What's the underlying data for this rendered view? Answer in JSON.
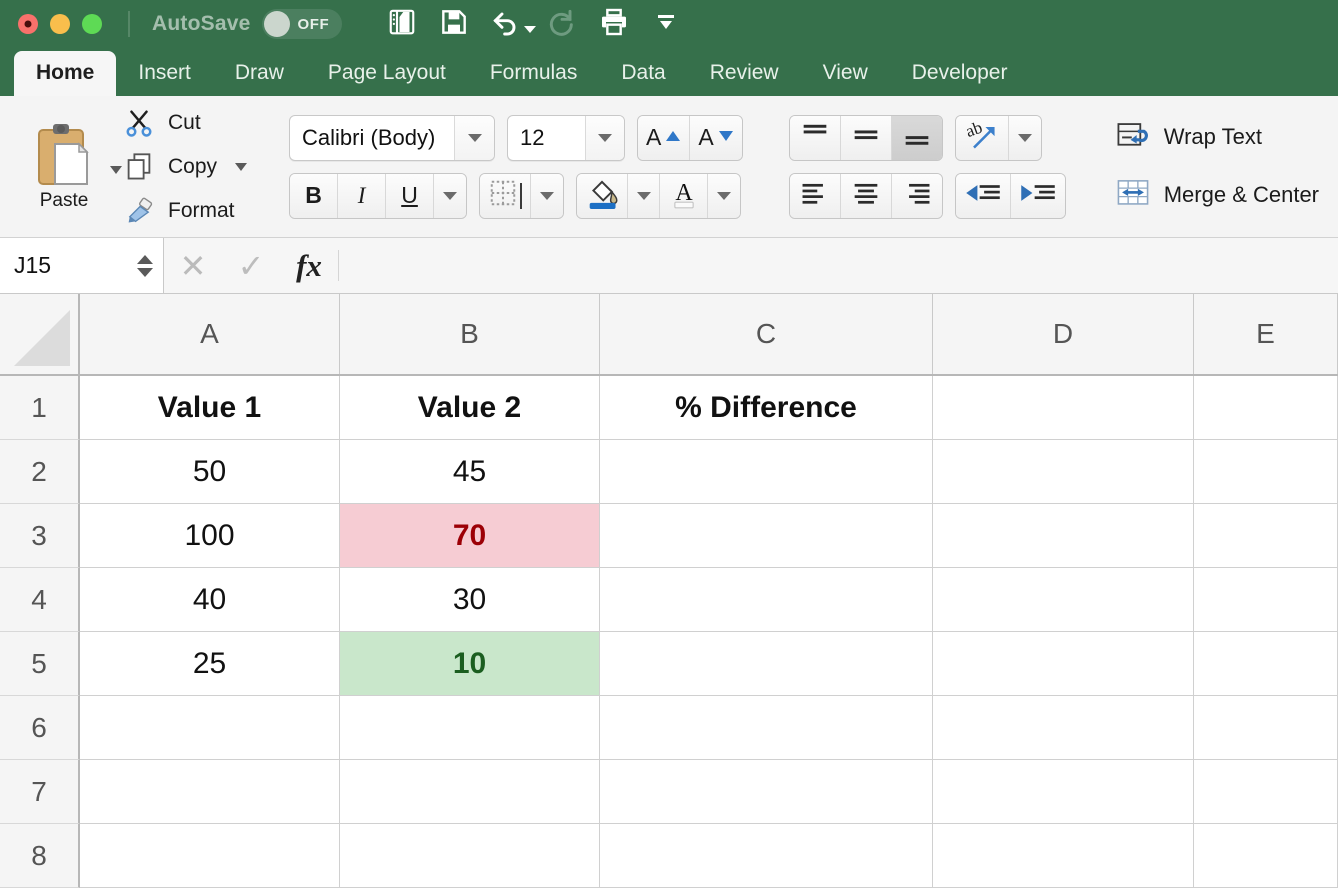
{
  "titlebar": {
    "autosave_label": "AutoSave",
    "autosave_state": "OFF",
    "buttons": [
      {
        "name": "new-from-template-icon",
        "tip": "New"
      },
      {
        "name": "save-icon",
        "tip": "Save"
      },
      {
        "name": "undo-icon",
        "tip": "Undo"
      },
      {
        "name": "redo-icon",
        "tip": "Redo"
      },
      {
        "name": "print-icon",
        "tip": "Print"
      },
      {
        "name": "customize-toolbar-icon",
        "tip": "Customize"
      }
    ],
    "green": "#36704B"
  },
  "ribbon_tabs": [
    {
      "label": "Home",
      "active": true
    },
    {
      "label": "Insert",
      "active": false
    },
    {
      "label": "Draw",
      "active": false
    },
    {
      "label": "Page Layout",
      "active": false
    },
    {
      "label": "Formulas",
      "active": false
    },
    {
      "label": "Data",
      "active": false
    },
    {
      "label": "Review",
      "active": false
    },
    {
      "label": "View",
      "active": false
    },
    {
      "label": "Developer",
      "active": false
    }
  ],
  "ribbon": {
    "clipboard": {
      "paste_label": "Paste",
      "cut_label": "Cut",
      "copy_label": "Copy",
      "format_label": "Format"
    },
    "font": {
      "font_name": "Calibri (Body)",
      "font_size": "12",
      "grow_label": "A",
      "shrink_label": "A",
      "bold_label": "B",
      "italic_label": "I",
      "underline_label": "U"
    },
    "alignment": {
      "wrap_text_label": "Wrap Text",
      "merge_center_label": "Merge & Center"
    }
  },
  "formula_bar": {
    "name_box": "J15",
    "formula_value": "",
    "cancel_label": "✕",
    "enter_label": "✓",
    "fx_label": "fx"
  },
  "sheet": {
    "columns": [
      "A",
      "B",
      "C",
      "D",
      "E"
    ],
    "rows": [
      "1",
      "2",
      "3",
      "4",
      "5",
      "6",
      "7",
      "8"
    ],
    "cells": {
      "A1": "Value 1",
      "B1": "Value 2",
      "C1": "% Difference",
      "D1": "",
      "E1": "",
      "A2": "50",
      "B2": "45",
      "C2": "",
      "D2": "",
      "E2": "",
      "A3": "100",
      "B3": "70",
      "C3": "",
      "D3": "",
      "E3": "",
      "A4": "40",
      "B4": "30",
      "C4": "",
      "D4": "",
      "E4": "",
      "A5": "25",
      "B5": "10",
      "C5": "",
      "D5": "",
      "E5": "",
      "A6": "",
      "B6": "",
      "C6": "",
      "D6": "",
      "E6": "",
      "A7": "",
      "B7": "",
      "C7": "",
      "D7": "",
      "E7": "",
      "A8": "",
      "B8": "",
      "C8": "",
      "D8": "",
      "E8": ""
    },
    "formatting": {
      "B3": {
        "fill": "#F6CCD3",
        "color": "#9C0006"
      },
      "B5": {
        "fill": "#C9E7CB",
        "color": "#1B5E20"
      }
    }
  }
}
